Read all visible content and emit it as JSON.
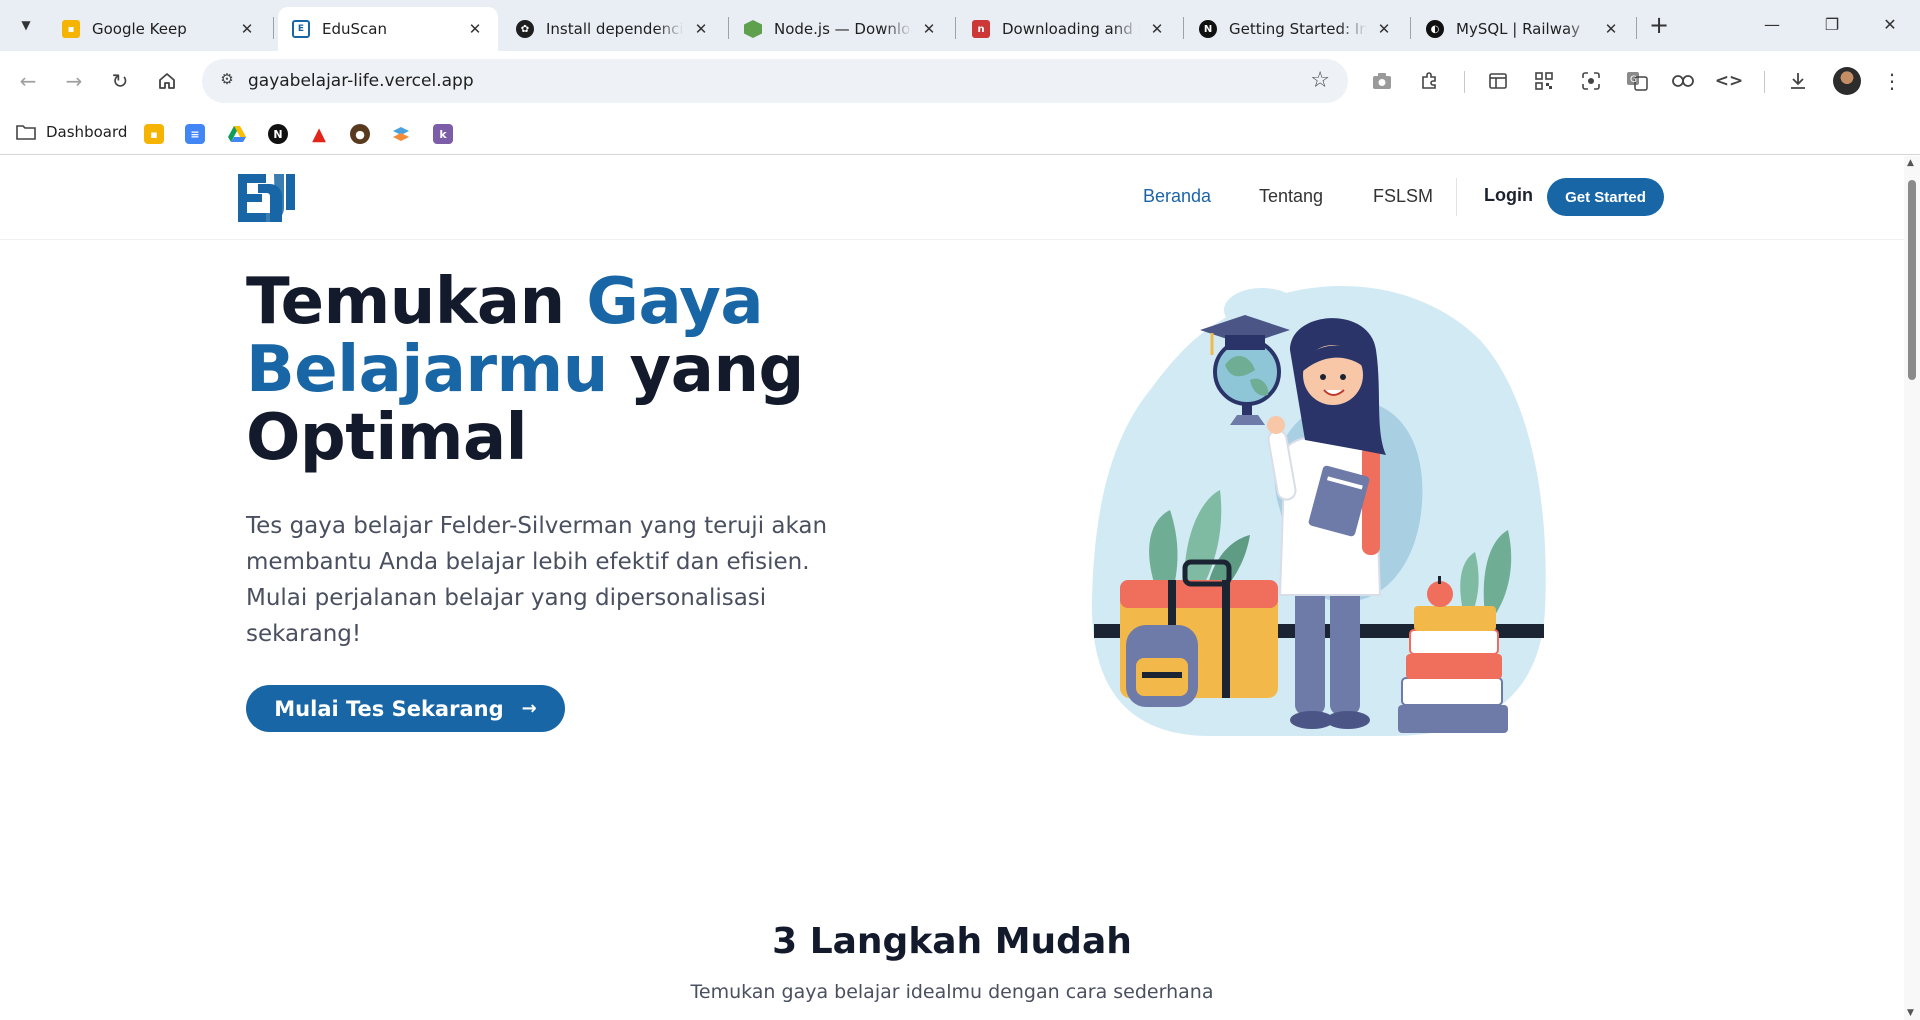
{
  "browser": {
    "tabs": [
      {
        "title": "Google Keep",
        "active": false,
        "favicon": "keep-icon",
        "color": "#f4b400"
      },
      {
        "title": "EduScan",
        "active": true,
        "favicon": "eduscan-icon",
        "color": "#1866a6"
      },
      {
        "title": "Install dependencies",
        "active": false,
        "favicon": "openai-icon",
        "color": "#1f1f1f"
      },
      {
        "title": "Node.js — Download",
        "active": false,
        "favicon": "nodejs-icon",
        "color": "#5fa04e"
      },
      {
        "title": "Downloading and installing",
        "active": false,
        "favicon": "npm-icon",
        "color": "#cb3837"
      },
      {
        "title": "Getting Started: Installation",
        "active": false,
        "favicon": "nextjs-icon",
        "color": "#111111"
      },
      {
        "title": "MySQL | Railway",
        "active": false,
        "favicon": "railway-icon",
        "color": "#111111"
      }
    ],
    "address_url": "gayabelajar-life.vercel.app",
    "bookmarks": {
      "folder_label": "Dashboard"
    }
  },
  "site": {
    "nav": {
      "beranda": "Beranda",
      "tentang": "Tentang",
      "fslsm": "FSLSM",
      "login": "Login",
      "get_started": "Get Started"
    },
    "hero": {
      "title_part1": "Temukan ",
      "title_hl1": "Gaya",
      "title_hl2": "Belajarmu",
      "title_part2": " yang",
      "title_part3": "Optimal",
      "description": "Tes gaya belajar Felder-Silverman yang teruji akan membantu Anda belajar lebih efektif dan efisien. Mulai perjalanan belajar yang dipersonalisasi sekarang!",
      "cta": "Mulai Tes Sekarang"
    },
    "steps": {
      "title": "3 Langkah Mudah",
      "subtitle": "Temukan gaya belajar idealmu dengan cara sederhana"
    }
  },
  "colors": {
    "brand": "#1866a6",
    "heading": "#121a2b"
  }
}
